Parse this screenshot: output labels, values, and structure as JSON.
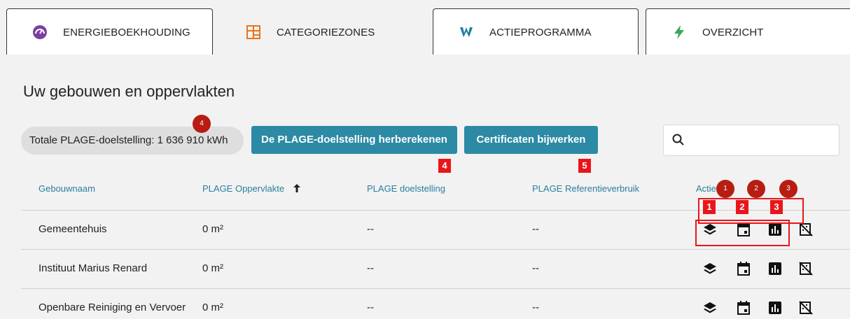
{
  "tabs": [
    {
      "label": "ENERGIEBOEKHOUDING",
      "icon": "gauge-icon"
    },
    {
      "label": "CATEGORIEZONES",
      "icon": "map-icon"
    },
    {
      "label": "ACTIEPROGRAMMA",
      "icon": "action-icon"
    },
    {
      "label": "OVERZICHT",
      "icon": "lightning-icon"
    }
  ],
  "page_title": "Uw gebouwen en oppervlakten",
  "total_pill": "Totale PLAGE-doelstelling: 1 636 910 kWh",
  "buttons": {
    "recalc": "De PLAGE-doelstelling herberekenen",
    "certificates": "Certificaten bijwerken"
  },
  "search": {
    "placeholder": ""
  },
  "table": {
    "headers": {
      "name": "Gebouwnaam",
      "area": "PLAGE Oppervlakte",
      "goal": "PLAGE doelstelling",
      "ref": "PLAGE Referentieverbruik",
      "actions": "Acties"
    },
    "rows": [
      {
        "name": "Gemeentehuis",
        "area": "0 m²",
        "goal": "--",
        "ref": "--"
      },
      {
        "name": "Instituut Marius Renard",
        "area": "0 m²",
        "goal": "--",
        "ref": "--"
      },
      {
        "name": "Openbare Reiniging en Vervoer",
        "area": "0 m²",
        "goal": "--",
        "ref": "--"
      }
    ]
  },
  "annotations": {
    "circle_pill": "4",
    "circle_1": "1",
    "circle_2": "2",
    "circle_3": "3",
    "sq_1": "1",
    "sq_2": "2",
    "sq_3": "3",
    "sq_4": "4",
    "sq_5": "5"
  },
  "colors": {
    "accent": "#2c8aa4",
    "annotation": "#e8161b"
  }
}
